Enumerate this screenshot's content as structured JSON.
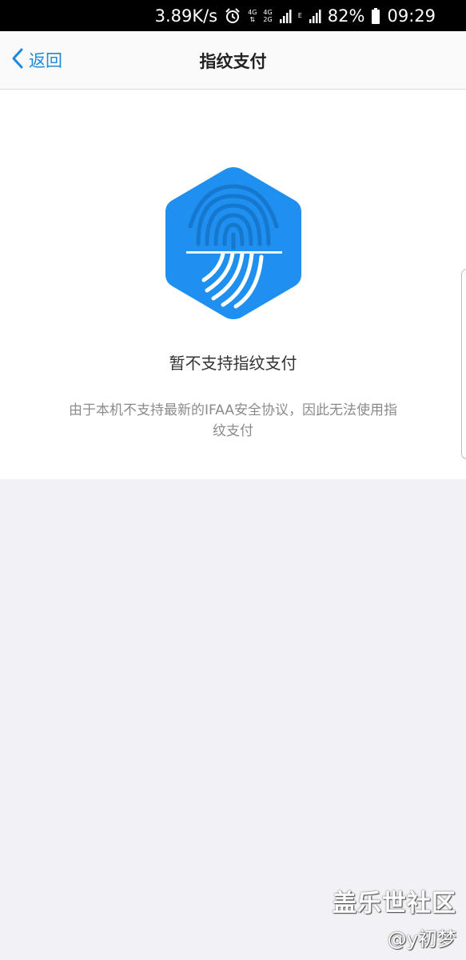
{
  "status_bar": {
    "speed": "3.89K/s",
    "network_1": "4G",
    "network_2_top": "4G",
    "network_2_bottom": "2G",
    "network_3": "E",
    "battery": "82%",
    "time": "09:29"
  },
  "nav": {
    "back_label": "返回",
    "title": "指纹支付"
  },
  "content": {
    "main_message": "暂不支持指纹支付",
    "sub_message": "由于本机不支持最新的IFAA安全协议，因此无法使用指纹支付"
  },
  "watermark": {
    "title": "盖乐世社区",
    "user": "@y初梦"
  },
  "colors": {
    "accent": "#1a8ae0",
    "icon_blue": "#1f8ff0",
    "background": "#f2f2f6"
  }
}
